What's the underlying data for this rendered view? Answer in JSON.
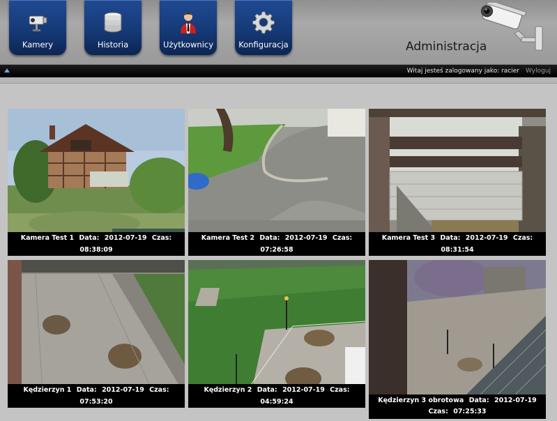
{
  "nav": {
    "items": [
      {
        "label": "Kamery",
        "icon": "camera-icon"
      },
      {
        "label": "Historia",
        "icon": "database-icon"
      },
      {
        "label": "Użytkownicy",
        "icon": "user-icon"
      },
      {
        "label": "Konfiguracja",
        "icon": "gear-icon"
      }
    ]
  },
  "header": {
    "title": "Administracja",
    "logo_icon": "cctv-camera-icon"
  },
  "status_bar": {
    "welcome": "Witaj jesteś zalogowany jako: racier",
    "logout": "Wyloguj",
    "collapse_icon": "collapse-arrow-icon"
  },
  "cameras": [
    {
      "name": "Kamera Test 1",
      "date_label": "Data:",
      "date": "2012-07-19",
      "time_label": "Czas:",
      "time": "08:38:09"
    },
    {
      "name": "Kamera Test 2",
      "date_label": "Data:",
      "date": "2012-07-19",
      "time_label": "Czas:",
      "time": "07:26:58"
    },
    {
      "name": "Kamera Test 3",
      "date_label": "Data:",
      "date": "2012-07-19",
      "time_label": "Czas:",
      "time": "08:31:54"
    },
    {
      "name": "Kędzierzyn 1",
      "date_label": "Data:",
      "date": "2012-07-19",
      "time_label": "Czas:",
      "time": "07:53:20"
    },
    {
      "name": "Kędzierzyn 2",
      "date_label": "Data:",
      "date": "2012-07-19",
      "time_label": "Czas:",
      "time": "04:59:24"
    },
    {
      "name": "Kędzierzyn 3 obrotowa",
      "date_label": "Data:",
      "date": "2012-07-19",
      "time_label": "Czas:",
      "time": "07:25:33"
    }
  ],
  "colors": {
    "nav_button": "#163a77",
    "caption_bg": "#000000",
    "status_bar": "#000000"
  }
}
